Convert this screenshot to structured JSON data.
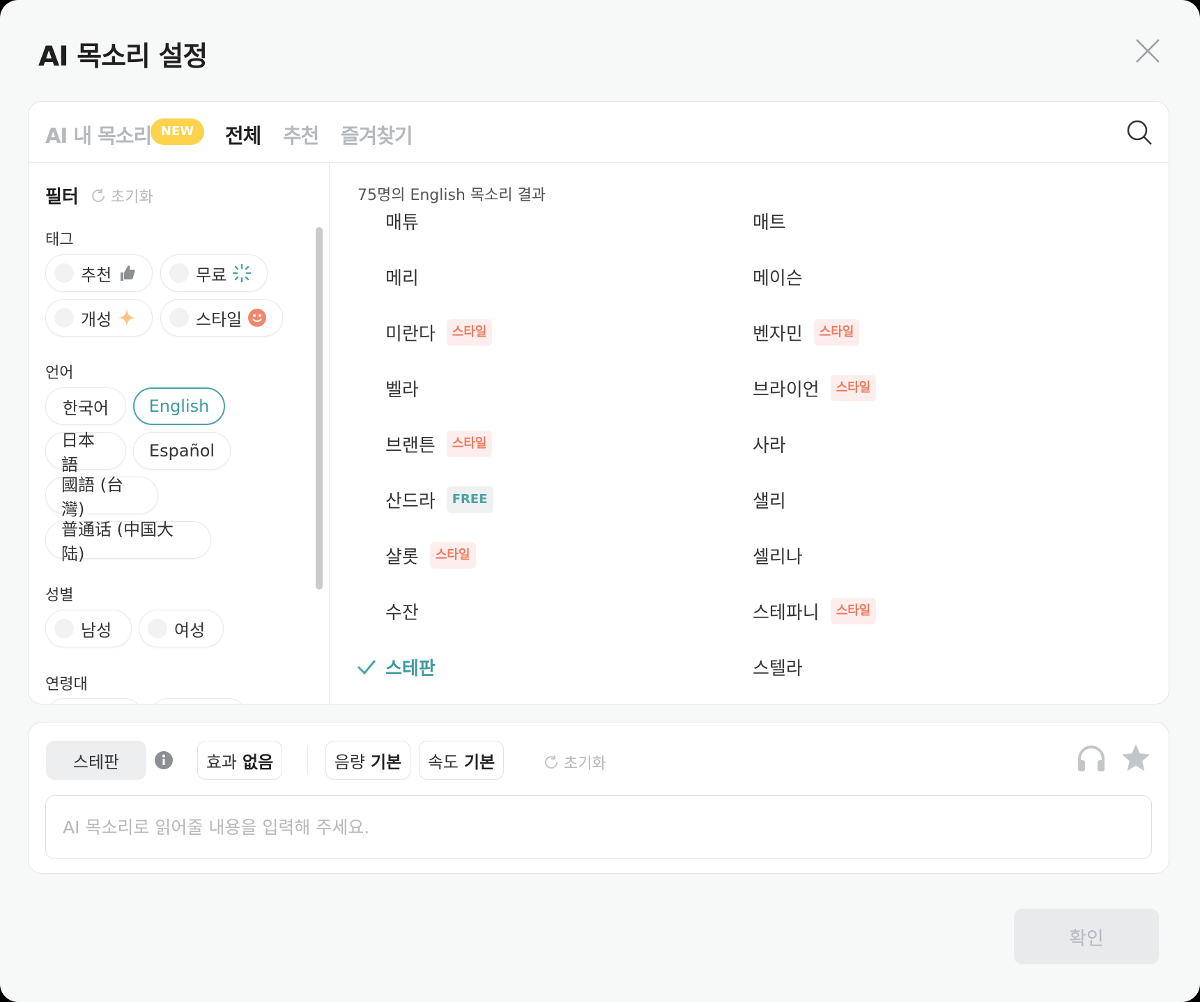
{
  "dialog": {
    "title": "AI 목소리 설정",
    "close_icon": "close-icon"
  },
  "tabs": {
    "my_voice": "AI 내 목소리",
    "new_badge": "NEW",
    "all": "전체",
    "recommended": "추천",
    "favorites": "즐겨찾기",
    "active": "전체"
  },
  "filter": {
    "title": "필터",
    "reset_label": "초기화",
    "tag_section": "태그",
    "tags": [
      {
        "label": "추천",
        "icon": "thumbs-up-icon"
      },
      {
        "label": "무료",
        "icon": "sparkle-dots-icon"
      },
      {
        "label": "개성",
        "icon": "four-point-star-icon"
      },
      {
        "label": "스타일",
        "icon": "smiley-icon"
      }
    ],
    "language_section": "언어",
    "languages": [
      "한국어",
      "English",
      "日本語",
      "Español",
      "國語 (台灣)",
      "普通话 (中国大陆)"
    ],
    "selected_language": "English",
    "gender_section": "성별",
    "genders": [
      "남성",
      "여성"
    ],
    "age_section": "연령대"
  },
  "results": {
    "count_text": "75명의 English 목소리 결과",
    "voices": [
      {
        "name": "매튜",
        "tag": ""
      },
      {
        "name": "매트",
        "tag": ""
      },
      {
        "name": "메리",
        "tag": ""
      },
      {
        "name": "메이슨",
        "tag": ""
      },
      {
        "name": "미란다",
        "tag": "스타일"
      },
      {
        "name": "벤자민",
        "tag": "스타일"
      },
      {
        "name": "벨라",
        "tag": ""
      },
      {
        "name": "브라이언",
        "tag": "스타일"
      },
      {
        "name": "브랜튼",
        "tag": "스타일"
      },
      {
        "name": "사라",
        "tag": ""
      },
      {
        "name": "산드라",
        "tag": "FREE"
      },
      {
        "name": "샐리",
        "tag": ""
      },
      {
        "name": "샬롯",
        "tag": "스타일"
      },
      {
        "name": "셀리나",
        "tag": ""
      },
      {
        "name": "수잔",
        "tag": ""
      },
      {
        "name": "스테파니",
        "tag": "스타일"
      },
      {
        "name": "스테판",
        "tag": "",
        "selected": true
      },
      {
        "name": "스텔라",
        "tag": ""
      }
    ]
  },
  "controls": {
    "voice_name": "스테판",
    "effect_label": "효과",
    "effect_value": "없음",
    "volume_label": "음량",
    "volume_value": "기본",
    "speed_label": "속도",
    "speed_value": "기본",
    "reset_label": "초기화",
    "input_placeholder": "AI 목소리로 읽어줄 내용을 입력해 주세요."
  },
  "confirm_label": "확인",
  "colors": {
    "accent": "#4aa3a8",
    "badge": "#fcd34d",
    "style_tag": "#f07a5e"
  }
}
